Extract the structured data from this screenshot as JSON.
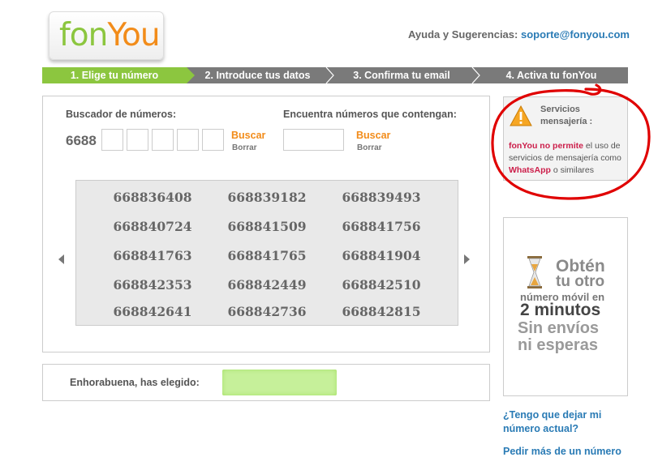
{
  "logo": {
    "part1": "fon",
    "part2": "You"
  },
  "help": {
    "label": "Ayuda y Sugerencias:",
    "email": "soporte@fonyou.com"
  },
  "steps": [
    {
      "label": "1. Elige tu número",
      "active": true
    },
    {
      "label": "2. Introduce tus datos",
      "active": false
    },
    {
      "label": "3. Confirma tu email",
      "active": false
    },
    {
      "label": "4. Activa tu fonYou",
      "active": false
    }
  ],
  "search": {
    "by_number_label": "Buscador de números:",
    "prefix": "6688",
    "digits": [
      "",
      "",
      "",
      "",
      ""
    ],
    "contains_label": "Encuentra números que contengan:",
    "contains_value": "",
    "buscar": "Buscar",
    "borrar": "Borrar"
  },
  "numbers": [
    [
      "668836408",
      "668839182",
      "668839493"
    ],
    [
      "668840724",
      "668841509",
      "668841756"
    ],
    [
      "668841763",
      "668841765",
      "668841904"
    ],
    [
      "668842353",
      "668842449",
      "668842510"
    ],
    [
      "668842641",
      "668842736",
      "668842815"
    ]
  ],
  "chosen": {
    "label": "Enhorabuena, has elegido:",
    "value": ""
  },
  "notice": {
    "title": "Servicios mensajería :",
    "text_hl1": "fonYou no permite",
    "text_1": " el uso de servicios de mensajería como ",
    "text_hl2": "WhatsApp",
    "text_2": " o similares"
  },
  "promo": {
    "line1": "Obtén",
    "line2": "tu otro",
    "line3": "número móvil en",
    "line4": "2 minutos",
    "line5": "Sin envíos",
    "line6": "ni esperas"
  },
  "links": {
    "keep_number": "¿Tengo que dejar mi número actual?",
    "more_numbers": "Pedir más de un número"
  },
  "colors": {
    "green": "#8cc63f",
    "orange": "#f28c1a",
    "grey_bar": "#7a7a7a",
    "link": "#2a7bb5",
    "alert": "#cc1e4a",
    "annotation_red": "#e00000"
  }
}
